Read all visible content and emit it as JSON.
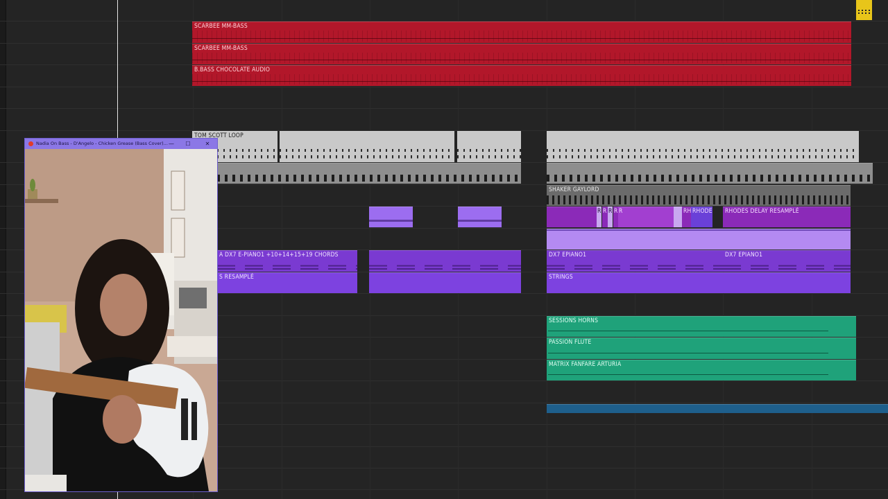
{
  "tracks": {
    "bass1": "SCARBEE MM-BASS",
    "bass2": "SCARBEE MM-BASS",
    "bass3": "B.BASS CHOCOLATE AUDIO",
    "loop": "TOM SCOTT LOOP",
    "shaker": "SHAKER GAYLORD",
    "rhodes_short": "R",
    "rhodes_mid": "RH",
    "rhodes": "RHODE",
    "rhodes_delay": "RHODES DELAY RESAMPLÉ",
    "epiano_left": "A DX7 E-PIANO1 +10+14+15+19 CHORDS",
    "epiano1": "DX7 EPIANO1",
    "epiano2": "DX7 EPIANO1",
    "strings_left": "S RESAMPLÉ",
    "strings": "STRINGS",
    "horns": "SESSIONS HORNS",
    "flute": "PASSION FLUTE",
    "fanfare": "MATRIX FANFARE ARTURIA"
  },
  "pip_window": {
    "title": "Nadia On Bass - D'Angelo - Chicken Grease (Bass Cover)...",
    "minimize": "—",
    "restore": "☐",
    "close": "✕"
  },
  "colors": {
    "bass": "#b2172a",
    "loop": "#c9c9c9",
    "purple": "#7a3ad1",
    "magenta": "#8b2ab8",
    "teal": "#1fa27a",
    "blue": "#1e5f8c",
    "window_titlebar": "#8b77e6",
    "marker": "#e8c51a"
  }
}
